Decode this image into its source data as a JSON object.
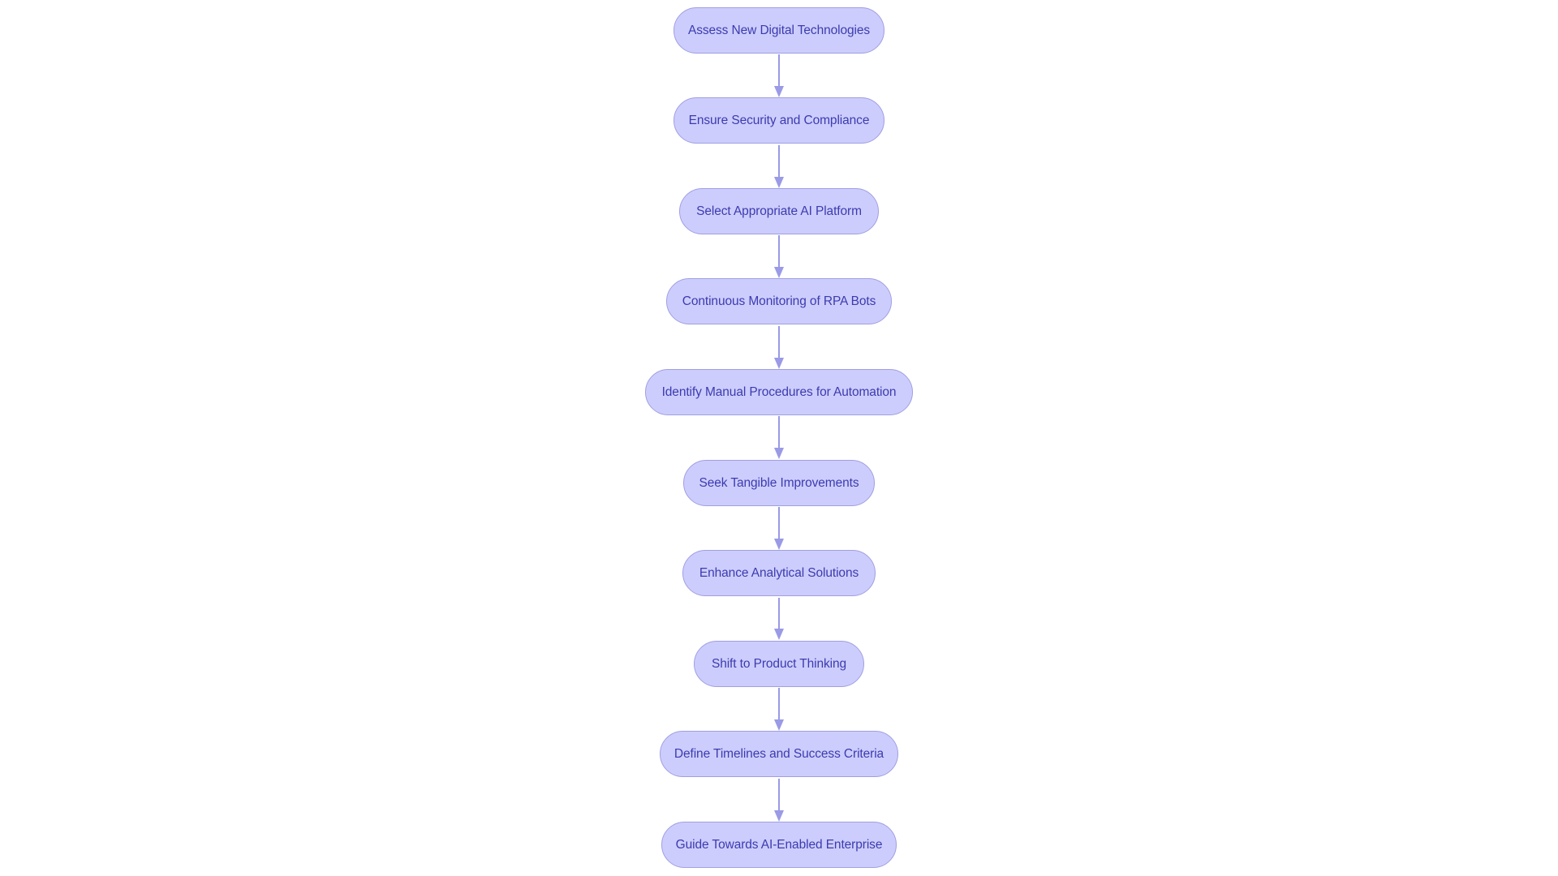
{
  "diagram": {
    "type": "flowchart",
    "direction": "top-to-bottom",
    "colors": {
      "node_fill": "#cdcdfd",
      "node_border": "#9f9fe3",
      "node_text": "#3b3bb0",
      "edge": "#9a9ae6",
      "background": "#ffffff"
    },
    "nodes": [
      {
        "id": "n1",
        "label": "Assess New Digital Technologies"
      },
      {
        "id": "n2",
        "label": "Ensure Security and Compliance"
      },
      {
        "id": "n3",
        "label": "Select Appropriate AI Platform"
      },
      {
        "id": "n4",
        "label": "Continuous Monitoring of RPA Bots"
      },
      {
        "id": "n5",
        "label": "Identify Manual Procedures for Automation"
      },
      {
        "id": "n6",
        "label": "Seek Tangible Improvements"
      },
      {
        "id": "n7",
        "label": "Enhance Analytical Solutions"
      },
      {
        "id": "n8",
        "label": "Shift to Product Thinking"
      },
      {
        "id": "n9",
        "label": "Define Timelines and Success Criteria"
      },
      {
        "id": "n10",
        "label": "Guide Towards AI-Enabled Enterprise"
      }
    ],
    "edges": [
      {
        "from": "n1",
        "to": "n2"
      },
      {
        "from": "n2",
        "to": "n3"
      },
      {
        "from": "n3",
        "to": "n4"
      },
      {
        "from": "n4",
        "to": "n5"
      },
      {
        "from": "n5",
        "to": "n6"
      },
      {
        "from": "n6",
        "to": "n7"
      },
      {
        "from": "n7",
        "to": "n8"
      },
      {
        "from": "n8",
        "to": "n9"
      },
      {
        "from": "n9",
        "to": "n10"
      }
    ]
  }
}
